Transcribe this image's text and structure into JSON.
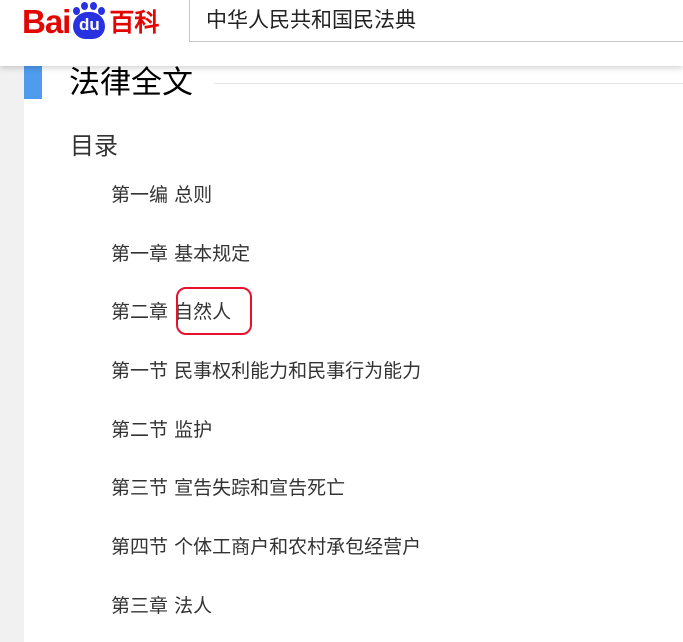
{
  "header": {
    "logo_bai": "Bai",
    "logo_du": "du",
    "logo_baike": "百科",
    "search_value": "中华人民共和国民法典",
    "brand_red": "#e10601",
    "brand_blue": "#2932e1"
  },
  "section": {
    "title": "法律全文",
    "accent_color": "#4f9cee"
  },
  "toc": {
    "heading": "目录",
    "items": [
      {
        "num": "第一编",
        "name": "总则"
      },
      {
        "num": "第一章",
        "name": "基本规定"
      },
      {
        "num": "第二章",
        "name": "自然人"
      },
      {
        "num": "第一节",
        "name": "民事权利能力和民事行为能力"
      },
      {
        "num": "第二节",
        "name": "监护"
      },
      {
        "num": "第三节",
        "name": "宣告失踪和宣告死亡"
      },
      {
        "num": "第四节",
        "name": "个体工商户和农村承包经营户"
      },
      {
        "num": "第三章",
        "name": "法人"
      }
    ],
    "highlighted_item": "自然人",
    "highlight_color": "#e8112d"
  }
}
